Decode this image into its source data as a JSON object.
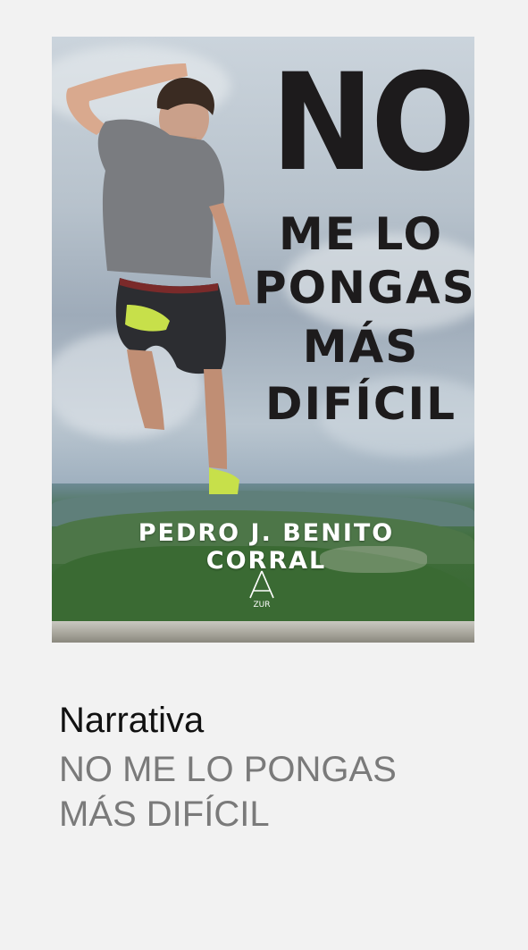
{
  "book": {
    "category": "Narrativa",
    "title_line1": "NO ME LO PONGAS",
    "title_line2": "MÁS DIFÍCIL"
  },
  "cover": {
    "title_big": "NO",
    "title_lines": [
      "ME LO",
      "PONGAS",
      "MÁS",
      "DIFÍCIL"
    ],
    "author": "PEDRO J. BENITO CORRAL",
    "publisher_logo_text": "ZUR",
    "publisher_logo_icon": "mountain-peak-icon"
  },
  "colors": {
    "background": "#f2f2f2",
    "category_text": "#111111",
    "title_text": "#7a7a7a",
    "cover_title": "#1d1b1c",
    "author_text": "#ffffff"
  }
}
